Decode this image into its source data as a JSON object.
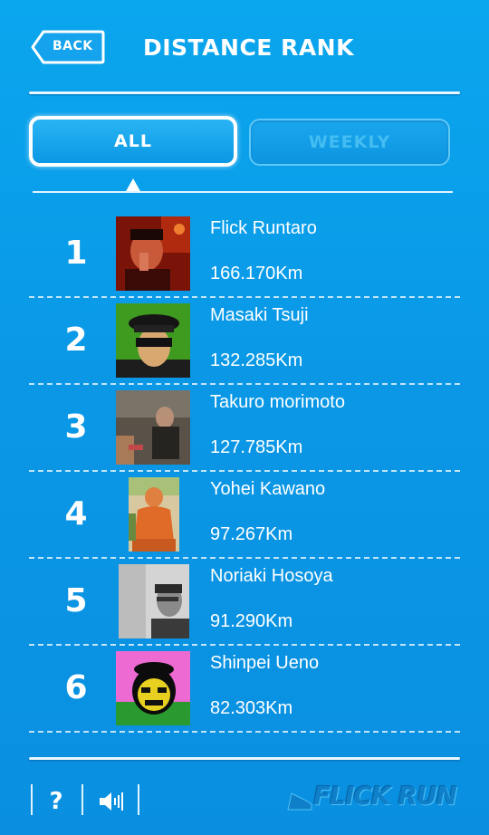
{
  "header": {
    "back_label": "BACK",
    "title": "DISTANCE RANK"
  },
  "tabs": [
    {
      "label": "ALL",
      "selected": true
    },
    {
      "label": "WEEKLY",
      "selected": false
    }
  ],
  "ranking": [
    {
      "rank": "1",
      "name": "Flick Runtaro",
      "distance": "166.170Km",
      "avatar": "photo-man-red-background"
    },
    {
      "rank": "2",
      "name": "Masaki Tsuji",
      "distance": "132.285Km",
      "avatar": "photo-man-cap-mask-green-background"
    },
    {
      "rank": "3",
      "name": "Takuro morimoto",
      "distance": "127.785Km",
      "avatar": "photo-man-sitting-outdoors"
    },
    {
      "rank": "4",
      "name": "Yohei Kawano",
      "distance": "97.267Km",
      "avatar": "photo-orange-illustrated-person"
    },
    {
      "rank": "5",
      "name": "Noriaki Hosoya",
      "distance": "91.290Km",
      "avatar": "photo-man-glasses-grayscale"
    },
    {
      "rank": "6",
      "name": "Shinpei Ueno",
      "distance": "82.303Km",
      "avatar": "photo-posterized-face-pink-yellow"
    }
  ],
  "footer": {
    "help_label": "?",
    "sound_icon": "speaker-icon",
    "logo_text": "FLICK RUN"
  },
  "colors": {
    "background": "#0a9ae6",
    "tab_inactive_text": "#43bdf2",
    "logo": "#0e7fc8"
  }
}
